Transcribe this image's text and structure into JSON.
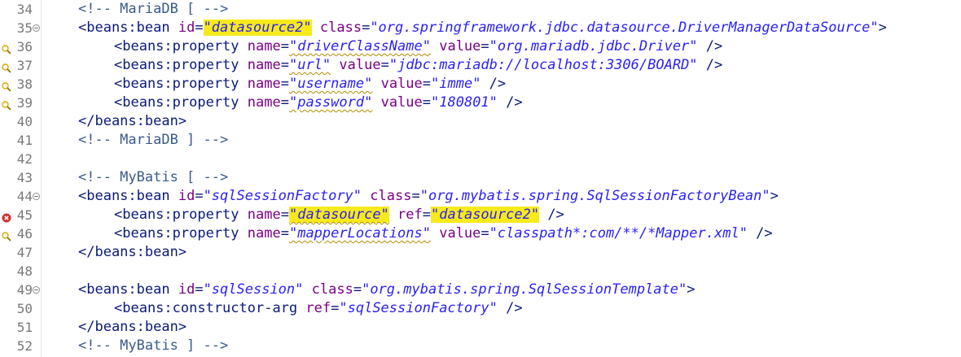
{
  "lines": [
    {
      "n": "34",
      "parts": [
        {
          "t": "<!-- MariaDB [ -->",
          "c": "cmt"
        }
      ]
    },
    {
      "n": "35",
      "parts": [
        {
          "t": "<beans:bean ",
          "c": "tag"
        },
        {
          "t": "id",
          "c": "attr"
        },
        {
          "t": "=",
          "c": "tag"
        },
        {
          "t": "\"datasource2\"",
          "c": "val hl"
        },
        {
          "t": " ",
          "c": "tag"
        },
        {
          "t": "class",
          "c": "attr"
        },
        {
          "t": "=",
          "c": "tag"
        },
        {
          "t": "\"org.springframework.jdbc.datasource.DriverManagerDataSource\"",
          "c": "val"
        },
        {
          "t": ">",
          "c": "tag"
        }
      ]
    },
    {
      "n": "36",
      "parts": [
        {
          "t": "<beans:property ",
          "c": "tag"
        },
        {
          "t": "name",
          "c": "attr"
        },
        {
          "t": "=",
          "c": "tag"
        },
        {
          "t": "\"driverClassName\"",
          "c": "val squig"
        },
        {
          "t": " ",
          "c": "tag"
        },
        {
          "t": "value",
          "c": "attr"
        },
        {
          "t": "=",
          "c": "tag"
        },
        {
          "t": "\"org.mariadb.jdbc.Driver\"",
          "c": "val"
        },
        {
          "t": " />",
          "c": "tag"
        }
      ]
    },
    {
      "n": "37",
      "parts": [
        {
          "t": "<beans:property ",
          "c": "tag"
        },
        {
          "t": "name",
          "c": "attr"
        },
        {
          "t": "=",
          "c": "tag"
        },
        {
          "t": "\"url\"",
          "c": "val squig"
        },
        {
          "t": " ",
          "c": "tag"
        },
        {
          "t": "value",
          "c": "attr"
        },
        {
          "t": "=",
          "c": "tag"
        },
        {
          "t": "\"jdbc:mariadb://localhost:3306/BOARD\"",
          "c": "val"
        },
        {
          "t": " />",
          "c": "tag"
        }
      ]
    },
    {
      "n": "38",
      "parts": [
        {
          "t": "<beans:property ",
          "c": "tag"
        },
        {
          "t": "name",
          "c": "attr"
        },
        {
          "t": "=",
          "c": "tag"
        },
        {
          "t": "\"username\"",
          "c": "val squig"
        },
        {
          "t": " ",
          "c": "tag"
        },
        {
          "t": "value",
          "c": "attr"
        },
        {
          "t": "=",
          "c": "tag"
        },
        {
          "t": "\"imme\"",
          "c": "val"
        },
        {
          "t": " />",
          "c": "tag"
        }
      ]
    },
    {
      "n": "39",
      "parts": [
        {
          "t": "<beans:property ",
          "c": "tag"
        },
        {
          "t": "name",
          "c": "attr"
        },
        {
          "t": "=",
          "c": "tag"
        },
        {
          "t": "\"password\"",
          "c": "val squig"
        },
        {
          "t": " ",
          "c": "tag"
        },
        {
          "t": "value",
          "c": "attr"
        },
        {
          "t": "=",
          "c": "tag"
        },
        {
          "t": "\"180801\"",
          "c": "val"
        },
        {
          "t": " />",
          "c": "tag"
        }
      ]
    },
    {
      "n": "40",
      "parts": [
        {
          "t": "</beans:bean>",
          "c": "tag"
        }
      ]
    },
    {
      "n": "41",
      "parts": [
        {
          "t": "<!-- MariaDB ] -->",
          "c": "cmt"
        }
      ]
    },
    {
      "n": "42",
      "parts": []
    },
    {
      "n": "43",
      "parts": [
        {
          "t": "<!-- MyBatis [ -->",
          "c": "cmt"
        }
      ]
    },
    {
      "n": "44",
      "parts": [
        {
          "t": "<beans:bean ",
          "c": "tag"
        },
        {
          "t": "id",
          "c": "attr"
        },
        {
          "t": "=",
          "c": "tag"
        },
        {
          "t": "\"sqlSessionFactory\"",
          "c": "val"
        },
        {
          "t": " ",
          "c": "tag"
        },
        {
          "t": "class",
          "c": "attr"
        },
        {
          "t": "=",
          "c": "tag"
        },
        {
          "t": "\"org.mybatis.spring.SqlSessionFactoryBean\"",
          "c": "val"
        },
        {
          "t": ">",
          "c": "tag"
        }
      ]
    },
    {
      "n": "45",
      "parts": [
        {
          "t": "<beans:property ",
          "c": "tag"
        },
        {
          "t": "name",
          "c": "attr"
        },
        {
          "t": "=",
          "c": "tag"
        },
        {
          "t": "\"datasource\"",
          "c": "val hl squig"
        },
        {
          "t": " ",
          "c": "tag"
        },
        {
          "t": "ref",
          "c": "attr"
        },
        {
          "t": "=",
          "c": "tag"
        },
        {
          "t": "\"datasource2\"",
          "c": "val hl"
        },
        {
          "t": " />",
          "c": "tag"
        }
      ]
    },
    {
      "n": "46",
      "parts": [
        {
          "t": "<beans:property ",
          "c": "tag"
        },
        {
          "t": "name",
          "c": "attr"
        },
        {
          "t": "=",
          "c": "tag"
        },
        {
          "t": "\"mapperLocations\"",
          "c": "val squig"
        },
        {
          "t": " ",
          "c": "tag"
        },
        {
          "t": "value",
          "c": "attr"
        },
        {
          "t": "=",
          "c": "tag"
        },
        {
          "t": "\"classpath*:com/**/*Mapper.xml\"",
          "c": "val"
        },
        {
          "t": " />",
          "c": "tag"
        }
      ]
    },
    {
      "n": "47",
      "parts": [
        {
          "t": "</beans:bean>",
          "c": "tag"
        }
      ]
    },
    {
      "n": "48",
      "parts": []
    },
    {
      "n": "49",
      "parts": [
        {
          "t": "<beans:bean ",
          "c": "tag"
        },
        {
          "t": "id",
          "c": "attr"
        },
        {
          "t": "=",
          "c": "tag"
        },
        {
          "t": "\"sqlSession\"",
          "c": "val"
        },
        {
          "t": " ",
          "c": "tag"
        },
        {
          "t": "class",
          "c": "attr"
        },
        {
          "t": "=",
          "c": "tag"
        },
        {
          "t": "\"org.mybatis.spring.SqlSessionTemplate\"",
          "c": "val"
        },
        {
          "t": ">",
          "c": "tag"
        }
      ]
    },
    {
      "n": "50",
      "parts": [
        {
          "t": "<beans:constructor-arg ",
          "c": "tag"
        },
        {
          "t": "ref",
          "c": "attr"
        },
        {
          "t": "=",
          "c": "tag"
        },
        {
          "t": "\"sqlSessionFactory\"",
          "c": "val"
        },
        {
          "t": " />",
          "c": "tag"
        }
      ]
    },
    {
      "n": "51",
      "parts": [
        {
          "t": "</beans:bean>",
          "c": "tag"
        }
      ]
    },
    {
      "n": "52",
      "parts": [
        {
          "t": "<!-- MyBatis ] -->",
          "c": "cmt"
        }
      ]
    }
  ],
  "markers": {
    "36": "warning-icon",
    "37": "warning-icon",
    "38": "warning-icon",
    "39": "warning-icon",
    "45": "error-icon",
    "46": "warning-icon"
  },
  "folds": {
    "35": "fold-minus-icon",
    "44": "fold-minus-icon",
    "49": "fold-minus-icon"
  },
  "indented": [
    "36",
    "37",
    "38",
    "39",
    "45",
    "46",
    "50"
  ],
  "colors": {
    "highlight": "#f7ea1c",
    "tag": "#0a1a7a",
    "attr": "#7a0088",
    "value": "#2a1ff5",
    "comment": "#3a5a8a",
    "error": "#d32f2f",
    "warning": "#e0a800"
  }
}
